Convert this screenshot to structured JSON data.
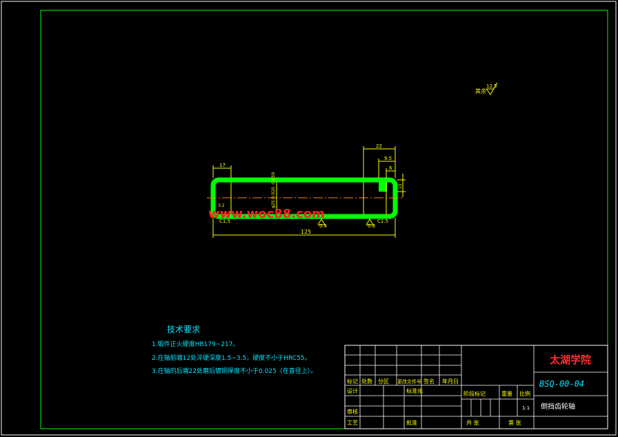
{
  "colors": {
    "background": "#000000",
    "frame": "#00ff00",
    "part": "#00ff00",
    "dimension": "#ffff00",
    "centerline": "#ff8000",
    "notes": "#00e5ff",
    "title_red": "#ff3030",
    "text_white": "#ffffff",
    "watermark": "#ff2020"
  },
  "surface_finish": {
    "label": "其余",
    "value": "12.5"
  },
  "dimensions": {
    "total_length": "125",
    "left_step": "17",
    "right_step": "22",
    "right_sub1": "9.5",
    "right_sub2": "6",
    "diameter": "φ25-0.020 -0.059",
    "groove_value": "15",
    "roughness_left": "3.2",
    "roughness_a": "0.4",
    "roughness_b": "0.8",
    "chamfer_left": "C1.5",
    "chamfer_right": "C1.5"
  },
  "watermark": {
    "text": "www.woc88.com"
  },
  "tech_requirements": {
    "heading": "技术要求",
    "items": [
      "1.锻件正火硬度HB179~217。",
      "2.在轴前端12处淬硬深度1.5~3.5，硬度不小于HRC55。",
      "3.在轴的后端22处磨后镀铜厚度不小于0.025（在直径上）。"
    ]
  },
  "title_block": {
    "school": "太湖学院",
    "drawing_no": "BSQ-00-04",
    "part_name": "倒挡齿轮轴",
    "revision_labels": [
      "标记",
      "处数",
      "分区",
      "更改文件号",
      "签名",
      "年月日"
    ],
    "row_design": "设计",
    "row_design_extra": "标准化",
    "row_review": "审核",
    "row_process": "工艺",
    "row_approve": "批准",
    "stage_label": "阶段标记",
    "weight_label": "重量",
    "scale_label": "比例",
    "scale_value": "1:1",
    "sheets_total": "共 张",
    "sheet_no": "第 张"
  }
}
